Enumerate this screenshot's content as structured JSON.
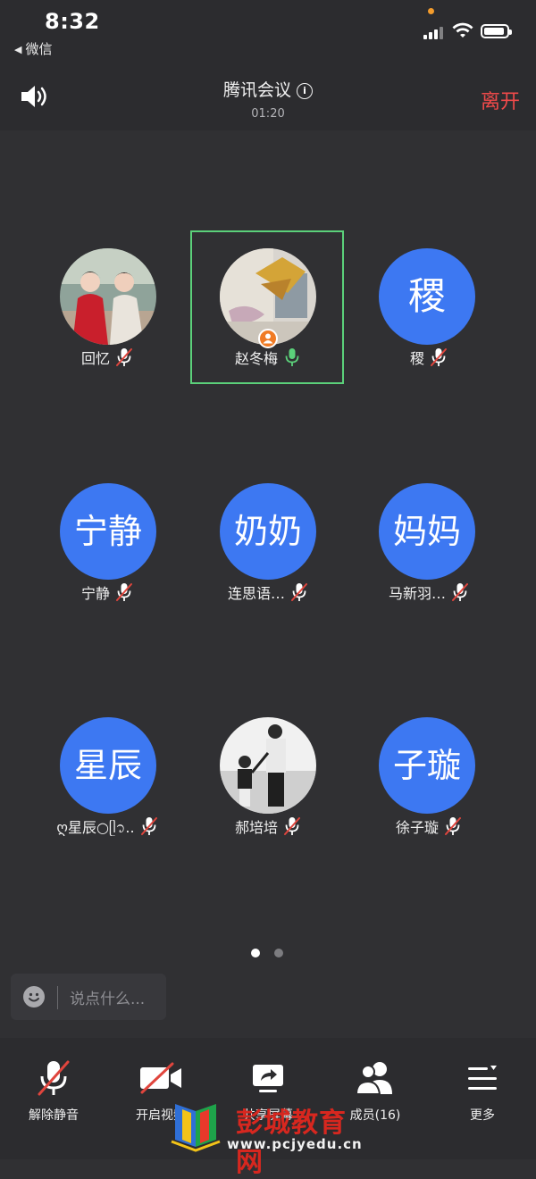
{
  "status_bar": {
    "time": "8:32",
    "back_app": "微信"
  },
  "header": {
    "title": "腾讯会议",
    "timer": "01:20",
    "leave_label": "离开",
    "leave_color": "#f04a4a"
  },
  "participants": [
    {
      "name": "回忆",
      "avatar_text": "",
      "avatar_type": "photo",
      "muted": true
    },
    {
      "name": "赵冬梅",
      "avatar_text": "",
      "avatar_type": "photo",
      "muted": false,
      "speaking": true,
      "host": true
    },
    {
      "name": "稷",
      "avatar_text": "稷",
      "avatar_type": "text",
      "muted": true
    },
    {
      "name": "宁静",
      "avatar_text": "宁静",
      "avatar_type": "text",
      "muted": true
    },
    {
      "name": "连思语…",
      "avatar_text": "奶奶",
      "avatar_type": "text",
      "muted": true
    },
    {
      "name": "马新羽…",
      "avatar_text": "妈妈",
      "avatar_type": "text",
      "muted": true
    },
    {
      "name": "ღ星辰○ᥫ᭡..",
      "avatar_text": "星辰",
      "avatar_type": "text",
      "muted": true
    },
    {
      "name": "郝培培",
      "avatar_text": "",
      "avatar_type": "photo",
      "muted": true
    },
    {
      "name": "徐子璇",
      "avatar_text": "子璇",
      "avatar_type": "text",
      "muted": true
    }
  ],
  "pagination": {
    "pages": 2,
    "current": 1
  },
  "chat": {
    "placeholder": "说点什么..."
  },
  "toolbar": {
    "unmute": "解除静音",
    "video": "开启视频",
    "share": "共享屏幕",
    "members": "成员(16)",
    "more": "更多"
  },
  "watermark": {
    "brand": "彭城教育网",
    "url": "www.pcjyedu.cn"
  },
  "colors": {
    "avatar_blue": "#3d78f2",
    "active_border": "#5bd07a",
    "mic_green": "#5bd07a",
    "mute_red": "#e0453d",
    "host_orange": "#f07b25"
  }
}
